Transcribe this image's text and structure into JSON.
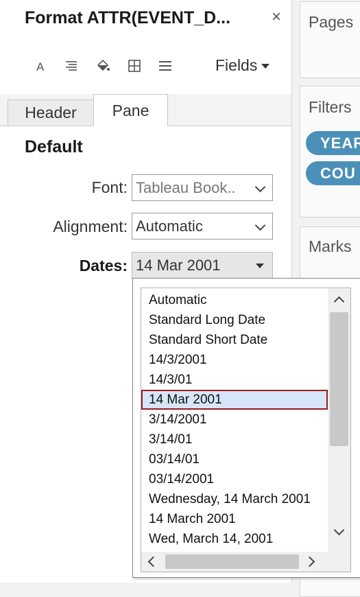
{
  "format_pane": {
    "title": "Format ATTR(EVENT_D...",
    "close_glyph": "×",
    "toolbar": {
      "icons": [
        "font-icon",
        "alignment-icon",
        "shading-icon",
        "borders-icon",
        "lines-icon"
      ],
      "fields_label": "Fields"
    },
    "tabs": [
      {
        "label": "Header",
        "active": false
      },
      {
        "label": "Pane",
        "active": true
      }
    ],
    "section_title": "Default",
    "font": {
      "label": "Font:",
      "value": "Tableau Book.."
    },
    "alignment": {
      "label": "Alignment:",
      "value": "Automatic"
    },
    "dates": {
      "label": "Dates:",
      "value": "14 Mar 2001"
    }
  },
  "shelves": {
    "pages": {
      "label": "Pages"
    },
    "filters": {
      "label": "Filters",
      "pills": [
        "YEAR",
        "COU"
      ]
    },
    "marks": {
      "label": "Marks"
    }
  },
  "date_options": {
    "items": [
      "Automatic",
      "Standard Long Date",
      "Standard Short Date",
      "14/3/2001",
      "14/3/01",
      "14 Mar 2001",
      "3/14/2001",
      "3/14/01",
      "03/14/01",
      "03/14/2001",
      "Wednesday, 14 March 2001",
      "14 March 2001",
      "Wed, March 14, 2001"
    ],
    "selected": "14 Mar 2001"
  },
  "colors": {
    "pill": "#4a90b8",
    "selection_fill": "#d6e6f8",
    "selection_border": "#9c1c1c"
  }
}
